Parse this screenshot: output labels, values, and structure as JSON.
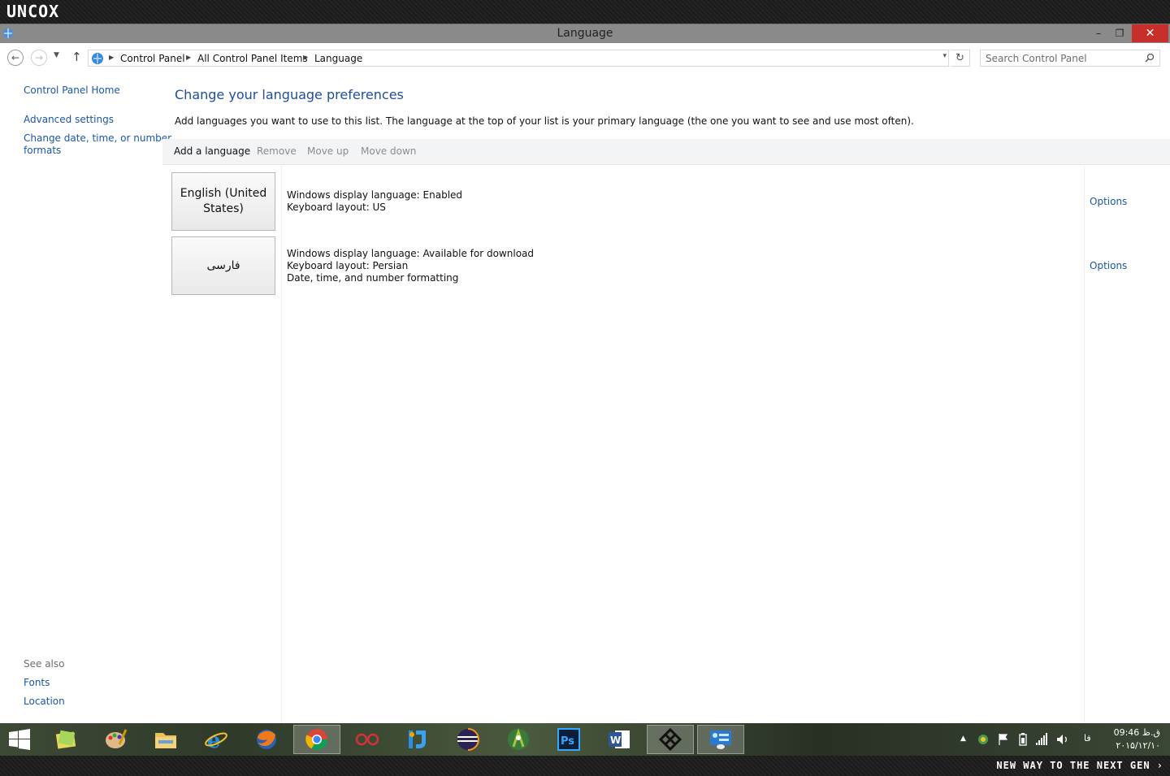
{
  "brand": "UNCOX",
  "window": {
    "title": "Language",
    "minimize": "–",
    "maximize": "❐",
    "close": "✕"
  },
  "nav": {
    "back": "←",
    "forward": "→",
    "recent": "▼",
    "up": "↑",
    "breadcrumbs": [
      "Control Panel",
      "All Control Panel Items",
      "Language"
    ],
    "dropdown": "▾",
    "refresh": "↻"
  },
  "search": {
    "placeholder": "Search Control Panel"
  },
  "sidebar": {
    "home": "Control Panel Home",
    "advanced": "Advanced settings",
    "datetime_line1": "Change date, time, or number",
    "datetime_line2": "formats",
    "see_also": "See also",
    "fonts": "Fonts",
    "location": "Location"
  },
  "main": {
    "title": "Change your language preferences",
    "description": "Add languages you want to use to this list. The language at the top of your list is your primary language (the one you want to see and use most often).",
    "commands": {
      "add": "Add a language",
      "remove": "Remove",
      "move_up": "Move up",
      "move_down": "Move down"
    },
    "languages": [
      {
        "name_line1": "English (United",
        "name_line2": "States)",
        "info": [
          "Windows display language: Enabled",
          "Keyboard layout: US"
        ],
        "options": "Options"
      },
      {
        "name_line1": "فارسی",
        "name_line2": "",
        "info": [
          "Windows display language: Available for download",
          "Keyboard layout: Persian",
          "Date, time, and number formatting"
        ],
        "options": "Options"
      }
    ]
  },
  "taskbar": {
    "apps": [
      "windows-explorer-icon",
      "paint-icon",
      "file-explorer-icon",
      "internet-explorer-icon",
      "firefox-icon",
      "chrome-icon",
      "infinity-app-icon",
      "jetbrains-icon",
      "eclipse-icon",
      "android-studio-icon",
      "photoshop-icon",
      "word-icon",
      "custom-app-icon",
      "control-panel-icon"
    ],
    "lang_indicator": "فا",
    "time": "ق.ظ 09:46",
    "date": "۲۰۱۵/۱۲/۱۰"
  },
  "slogan": "NEW WAY TO THE NEXT GEN ›",
  "colors": {
    "link": "#1a57a8",
    "title": "#1e4e9c",
    "close": "#c7302a"
  }
}
